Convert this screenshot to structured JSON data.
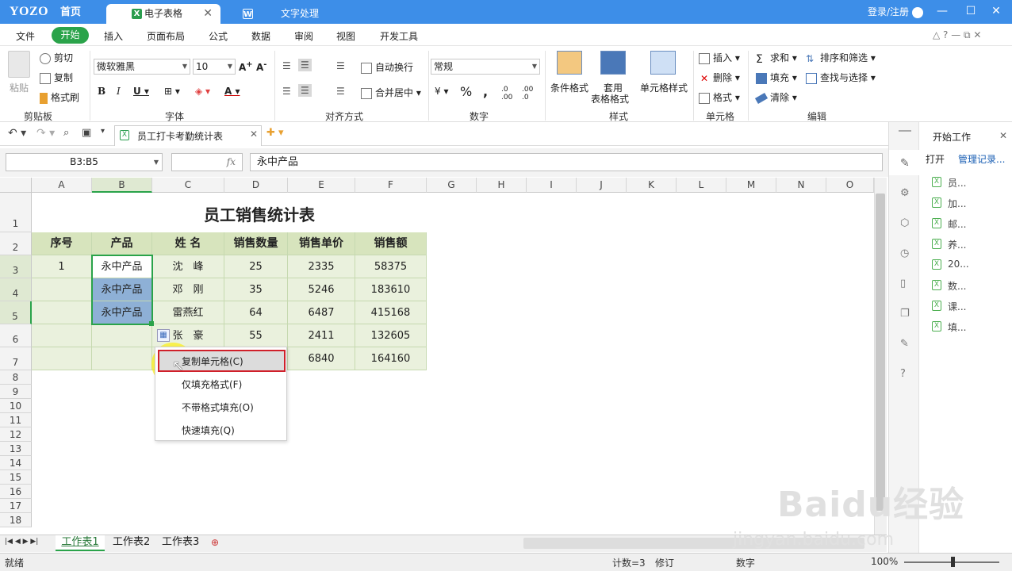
{
  "titlebar": {
    "logo": "YOZO",
    "home": "首页",
    "tab_spreadsheet": "电子表格",
    "tab_doc": "文字处理",
    "login": "登录/注册"
  },
  "menubar": {
    "items": [
      "文件",
      "开始",
      "插入",
      "页面布局",
      "公式",
      "数据",
      "审阅",
      "视图",
      "开发工具"
    ]
  },
  "ribbon": {
    "clipboard": {
      "paste": "粘贴",
      "cut": "剪切",
      "copy": "复制",
      "format_painter": "格式刷",
      "group": "剪贴板"
    },
    "font": {
      "font_name": "微软雅黑",
      "font_size": "10",
      "group": "字体"
    },
    "align": {
      "wrap": "自动换行",
      "merge": "合并居中",
      "group": "对齐方式"
    },
    "number": {
      "format": "常规",
      "group": "数字"
    },
    "style": {
      "cond": "条件格式",
      "table_fmt_1": "套用",
      "table_fmt_2": "表格格式",
      "cell_style": "单元格样式",
      "group": "样式"
    },
    "cells": {
      "insert": "插入",
      "delete": "删除",
      "format": "格式",
      "group": "单元格"
    },
    "edit": {
      "sum": "求和",
      "fill": "填充",
      "clear": "清除",
      "sort": "排序和筛选",
      "find": "查找与选择",
      "group": "编辑"
    }
  },
  "filetab": {
    "name": "员工打卡考勤统计表"
  },
  "formula": {
    "namebox": "B3:B5",
    "fx": "fx",
    "content": "永中产品"
  },
  "sheet": {
    "columns": [
      "A",
      "B",
      "C",
      "D",
      "E",
      "F",
      "G",
      "H",
      "I",
      "J",
      "K",
      "L",
      "M",
      "N",
      "O"
    ],
    "rows": [
      "1",
      "2",
      "3",
      "4",
      "5",
      "6",
      "7",
      "8",
      "9",
      "10",
      "11",
      "12",
      "13",
      "14",
      "15",
      "16",
      "17",
      "18"
    ],
    "title": "员工销售统计表",
    "headers": [
      "序号",
      "产品",
      "姓 名",
      "销售数量",
      "销售单价",
      "销售额"
    ],
    "data": [
      [
        "1",
        "永中产品",
        "沈　峰",
        "25",
        "2335",
        "58375"
      ],
      [
        "",
        "永中产品",
        "邓　刚",
        "35",
        "5246",
        "183610"
      ],
      [
        "",
        "永中产品",
        "雷燕红",
        "64",
        "6487",
        "415168"
      ],
      [
        "",
        "",
        "张　豪",
        "55",
        "2411",
        "132605"
      ],
      [
        "",
        "",
        "",
        "",
        "6840",
        "164160"
      ]
    ]
  },
  "context_menu": {
    "items": [
      "复制单元格(C)",
      "仅填充格式(F)",
      "不带格式填充(O)",
      "快速填充(Q)"
    ]
  },
  "side_panel": {
    "title": "开始工作",
    "open": "打开",
    "manage": "管理记录...",
    "files": [
      "员...",
      "加...",
      "邮...",
      "养...",
      "20...",
      "数...",
      "课...",
      "填..."
    ]
  },
  "sheet_tabs": [
    "工作表1",
    "工作表2",
    "工作表3"
  ],
  "status": {
    "ready": "就绪",
    "count": "计数=3",
    "revise": "修订",
    "mode": "数字",
    "zoom": "100%"
  },
  "watermark": {
    "brand": "Baidu经验",
    "url": "jingyan.baidu.com"
  }
}
